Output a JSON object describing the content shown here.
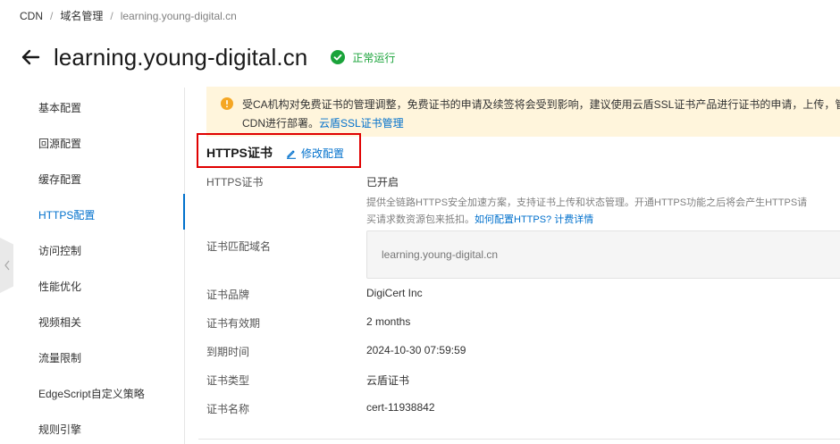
{
  "breadcrumb": {
    "items": [
      "CDN",
      "域名管理",
      "learning.young-digital.cn"
    ],
    "separator": "/"
  },
  "header": {
    "title": "learning.young-digital.cn",
    "status": "正常运行",
    "status_color": "#1aa33a"
  },
  "sidebar": {
    "items": [
      {
        "label": "基本配置",
        "active": false
      },
      {
        "label": "回源配置",
        "active": false
      },
      {
        "label": "缓存配置",
        "active": false
      },
      {
        "label": "HTTPS配置",
        "active": true
      },
      {
        "label": "访问控制",
        "active": false
      },
      {
        "label": "性能优化",
        "active": false
      },
      {
        "label": "视频相关",
        "active": false
      },
      {
        "label": "流量限制",
        "active": false
      },
      {
        "label": "EdgeScript自定义策略",
        "active": false
      },
      {
        "label": "规则引擎",
        "active": false
      }
    ],
    "accent": "#0070cc"
  },
  "notice": {
    "line1": "受CA机构对免费证书的管理调整，免费证书的申请及续签将会受到影响，建议使用云盾SSL证书产品进行证书的申请，上传，管",
    "line2_prefix": "CDN进行部署。",
    "link": "云盾SSL证书管理",
    "icon": "warning-icon",
    "background": "#fff5dc"
  },
  "section": {
    "title": "HTTPS证书",
    "edit_label": "修改配置",
    "highlight_color": "#e00000"
  },
  "fields": {
    "https_cert": {
      "label": "HTTPS证书",
      "value": "已开启"
    },
    "description": {
      "line1": "提供全链路HTTPS安全加速方案，支持证书上传和状态管理。开通HTTPS功能之后将会产生HTTPS请",
      "line2_prefix": "买请求数资源包来抵扣。",
      "link1": "如何配置HTTPS?",
      "link2": "计费详情"
    },
    "match_domain": {
      "label": "证书匹配域名",
      "value": "learning.young-digital.cn"
    },
    "brand": {
      "label": "证书品牌",
      "value": "DigiCert Inc"
    },
    "validity": {
      "label": "证书有效期",
      "value": "2 months"
    },
    "expiry": {
      "label": "到期时间",
      "value": "2024-10-30 07:59:59"
    },
    "type": {
      "label": "证书类型",
      "value": "云盾证书"
    },
    "name": {
      "label": "证书名称",
      "value": "cert-11938842"
    }
  }
}
